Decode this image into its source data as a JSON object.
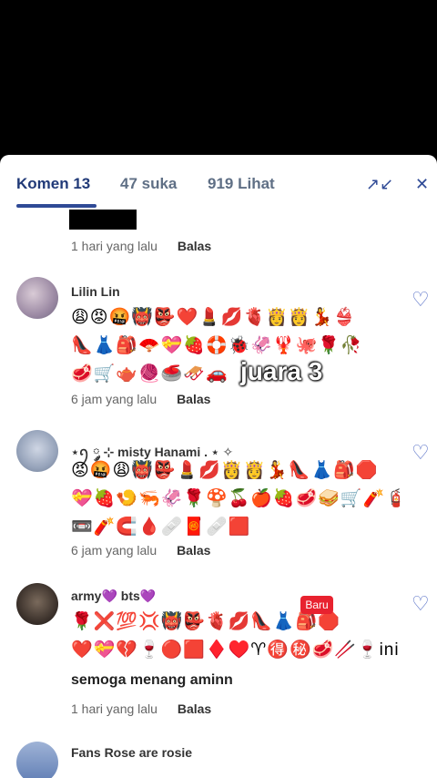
{
  "tabs": {
    "comments": "Komen 13",
    "likes": "47 suka",
    "views": "919 Lihat"
  },
  "icons": {
    "expand": "↗↙",
    "close": "✕",
    "heart": "♡"
  },
  "first_comment": {
    "time": "1 hari yang lalu",
    "reply": "Balas"
  },
  "comments": [
    {
      "name": "Lilin Lin",
      "emoji_lines": [
        "😩😡🤬👹👺❤️💄💋🫀👸👸💃👙",
        "👠👗🎒🪭💝🍓🛟🐞🦑🦞🐙🌹🥀",
        "🥩🛒🫖🧶🥌🛷🚗"
      ],
      "time": "6 jam yang lalu",
      "reply": "Balas"
    },
    {
      "name": "⋆ꪆ ༘ ⊹ misty Hanami . ⋆ ✧",
      "emoji_lines": [
        "😡🤬😩👹👺💄💋👸👸💃👠👗🎒🛑",
        "💝🍓🍤🦐🦑🌹🍄🍒🍎🍓🥩🥪🛒🧨🧯",
        "📼🧨🧲🩸🩹🧧🩹🟥"
      ],
      "time": "6 jam yang lalu",
      "reply": "Balas"
    },
    {
      "name": "army💜 bts💜",
      "emoji_lines": [
        "🌹❌💯💢👹👺🫀💋👠👗🎒🛑",
        "❤️💝💔🍷🔴🟥♦️♥️♈🉐㊙️🥩🥢🍷ini"
      ],
      "text": "semoga menang aminn",
      "time": "1 hari yang lalu",
      "reply": "Balas"
    }
  ],
  "last_comment": {
    "name": "Fans Rose are rosie",
    "badge": "Baru"
  },
  "overlay": "juara 3"
}
